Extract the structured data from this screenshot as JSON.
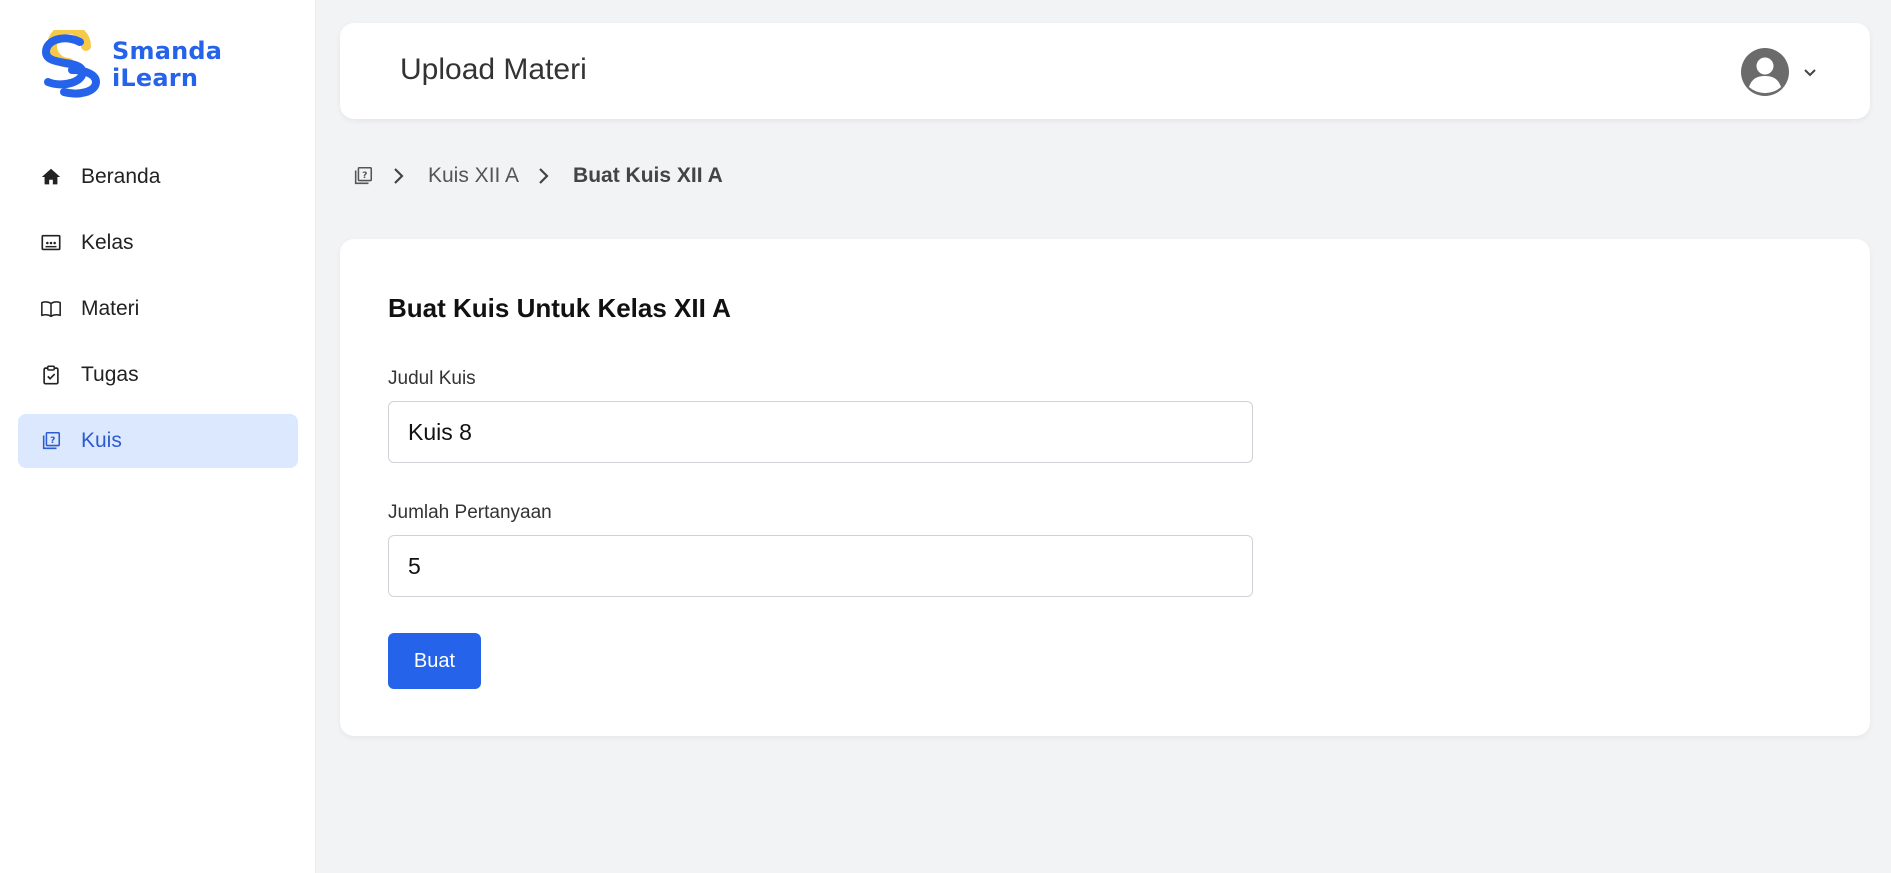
{
  "brand": {
    "line1": "Smanda",
    "line2": "iLearn"
  },
  "sidebar": {
    "items": [
      {
        "label": "Beranda",
        "icon": "home-icon"
      },
      {
        "label": "Kelas",
        "icon": "class-board-icon"
      },
      {
        "label": "Materi",
        "icon": "book-icon"
      },
      {
        "label": "Tugas",
        "icon": "clipboard-check-icon"
      },
      {
        "label": "Kuis",
        "icon": "quiz-icon",
        "active": true
      }
    ]
  },
  "header": {
    "title": "Upload Materi",
    "avatar_icon": "user-avatar-icon",
    "menu_icon": "chevron-down-icon"
  },
  "breadcrumb": {
    "home_icon": "quiz-icon",
    "items": [
      {
        "label": "Kuis XII A"
      },
      {
        "label": "Buat Kuis XII A"
      }
    ]
  },
  "form": {
    "title": "Buat Kuis Untuk Kelas XII A",
    "quiz_title": {
      "label": "Judul Kuis",
      "value": "Kuis 8"
    },
    "question_count": {
      "label": "Jumlah Pertanyaan",
      "value": "5"
    },
    "submit_label": "Buat"
  },
  "colors": {
    "accent": "#2563eb",
    "active_bg": "#dbe8fd",
    "logo_yellow": "#f7c948",
    "page_bg": "#f2f3f5"
  }
}
